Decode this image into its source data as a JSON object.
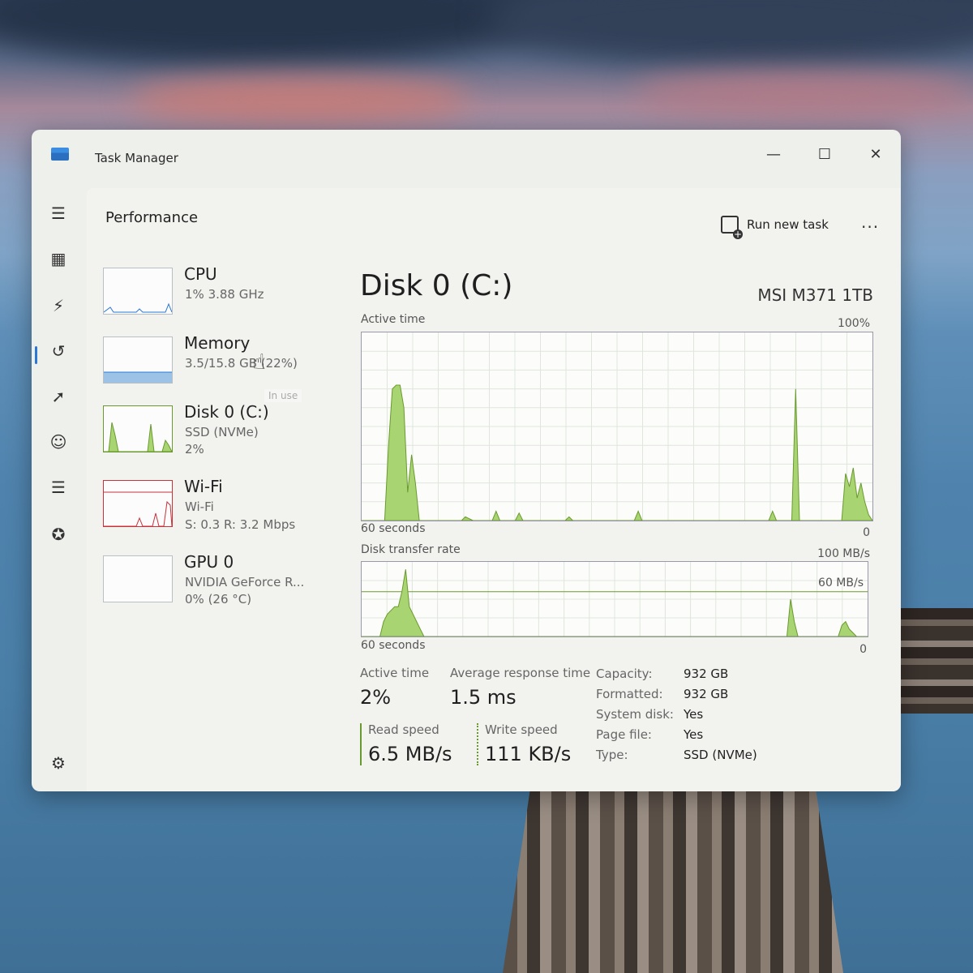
{
  "window": {
    "title": "Task Manager"
  },
  "header": {
    "page_title": "Performance",
    "run_new_task": "Run new task",
    "more": "..."
  },
  "devices": [
    {
      "name": "CPU",
      "line1": "1%  3.88 GHz",
      "line2": ""
    },
    {
      "name": "Memory",
      "line1": "3.5/15.8 GB (22%)",
      "line2": ""
    },
    {
      "name": "Disk 0 (C:)",
      "line1": "SSD (NVMe)",
      "line2": "2%"
    },
    {
      "name": "Wi-Fi",
      "line1": "Wi-Fi",
      "line2": "S: 0.3  R: 3.2 Mbps"
    },
    {
      "name": "GPU 0",
      "line1": "NVIDIA GeForce R...",
      "line2": "0%  (26 °C)"
    }
  ],
  "tooltip": "In use",
  "detail": {
    "title": "Disk 0 (C:)",
    "model": "MSI M371 1TB",
    "active_graph": {
      "label": "Active time",
      "max_label": "100%",
      "x_left": "60 seconds",
      "x_right": "0",
      "values": [
        0,
        0,
        0,
        0,
        0,
        0,
        0,
        40,
        70,
        72,
        72,
        60,
        15,
        35,
        20,
        0,
        0,
        0,
        0,
        0,
        0,
        0,
        0,
        0,
        0,
        0,
        0,
        2,
        1,
        0,
        0,
        0,
        0,
        0,
        0,
        5,
        0,
        0,
        0,
        0,
        0,
        4,
        0,
        0,
        0,
        0,
        0,
        0,
        0,
        0,
        0,
        0,
        0,
        0,
        2,
        0,
        0,
        0,
        0,
        0,
        0,
        0,
        0,
        0,
        0,
        0,
        0,
        0,
        0,
        0,
        0,
        0,
        5,
        0,
        0,
        0,
        0,
        0,
        0,
        0,
        0,
        0,
        0,
        0,
        0,
        0,
        0,
        0,
        0,
        0,
        0,
        0,
        0,
        0,
        0,
        0,
        0,
        0,
        0,
        0,
        0,
        0,
        0,
        0,
        0,
        0,
        0,
        5,
        0,
        0,
        0,
        0,
        0,
        70,
        0,
        0,
        0,
        0,
        0,
        0,
        0,
        0,
        0,
        0,
        0,
        0,
        25,
        18,
        28,
        12,
        20,
        10,
        3,
        0
      ]
    },
    "transfer_graph": {
      "label": "Disk transfer rate",
      "max_label": "100 MB/s",
      "mid_label": "60 MB/s",
      "x_left": "60 seconds",
      "x_right": "0",
      "values": [
        0,
        0,
        0,
        0,
        0,
        0,
        20,
        30,
        35,
        40,
        40,
        60,
        90,
        40,
        30,
        20,
        10,
        0,
        0,
        0,
        0,
        0,
        0,
        0,
        0,
        0,
        0,
        0,
        0,
        0,
        0,
        0,
        0,
        0,
        0,
        0,
        0,
        0,
        0,
        0,
        0,
        0,
        0,
        0,
        0,
        0,
        0,
        0,
        0,
        0,
        0,
        0,
        0,
        0,
        0,
        0,
        0,
        0,
        0,
        0,
        0,
        0,
        0,
        0,
        0,
        0,
        0,
        0,
        0,
        0,
        0,
        0,
        0,
        0,
        0,
        0,
        0,
        0,
        0,
        0,
        0,
        0,
        0,
        0,
        0,
        0,
        0,
        0,
        0,
        0,
        0,
        0,
        0,
        0,
        0,
        0,
        0,
        0,
        0,
        0,
        0,
        0,
        0,
        0,
        0,
        0,
        0,
        0,
        0,
        0,
        0,
        0,
        0,
        0,
        0,
        0,
        0,
        50,
        20,
        0,
        0,
        0,
        0,
        0,
        0,
        0,
        0,
        0,
        0,
        0,
        0,
        15,
        20,
        10,
        5,
        0,
        0,
        0,
        0
      ]
    },
    "stats": {
      "active_time_label": "Active time",
      "active_time_value": "2%",
      "avg_response_label": "Average response time",
      "avg_response_value": "1.5 ms",
      "read_label": "Read speed",
      "read_value": "6.5 MB/s",
      "write_label": "Write speed",
      "write_value": "111 KB/s"
    },
    "properties": [
      {
        "key": "Capacity:",
        "value": "932 GB"
      },
      {
        "key": "Formatted:",
        "value": "932 GB"
      },
      {
        "key": "System disk:",
        "value": "Yes"
      },
      {
        "key": "Page file:",
        "value": "Yes"
      },
      {
        "key": "Type:",
        "value": "SSD (NVMe)"
      }
    ]
  },
  "colors": {
    "disk_fill": "#a8d472",
    "disk_line": "#6a9a2e",
    "wifi_line": "#c8323a",
    "memory_fill": "#9cc3e6",
    "accent": "#2a78d6"
  }
}
